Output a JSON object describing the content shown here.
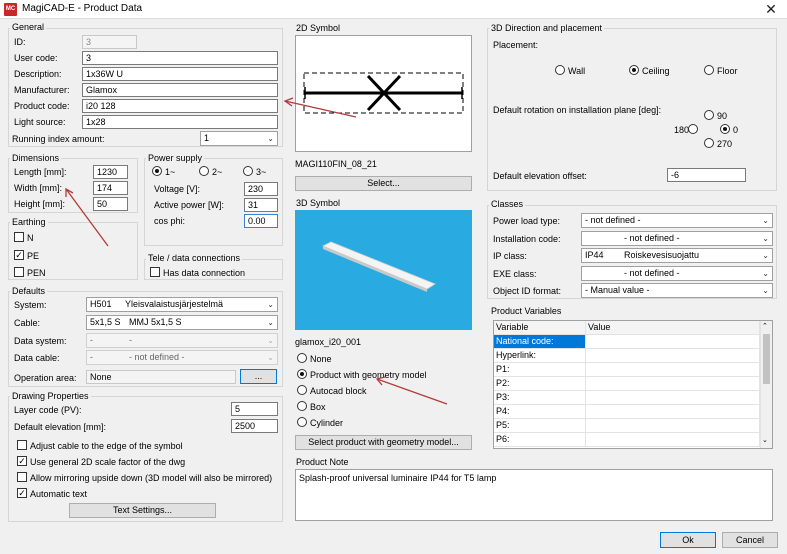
{
  "window": {
    "title": "MagiCAD-E - Product Data",
    "icon_text": "MC",
    "close_glyph": "✕"
  },
  "general": {
    "label": "General",
    "id_label": "ID:",
    "id_value": "3",
    "user_code_label": "User code:",
    "user_code_value": "3",
    "description_label": "Description:",
    "description_value": "1x36W U",
    "manufacturer_label": "Manufacturer:",
    "manufacturer_value": "Glamox",
    "product_code_label": "Product code:",
    "product_code_value": "i20 128",
    "light_source_label": "Light source:",
    "light_source_value": "1x28",
    "running_index_label": "Running index amount:",
    "running_index_value": "1"
  },
  "dimensions": {
    "label": "Dimensions",
    "length_label": "Length [mm]:",
    "length_value": "1230",
    "width_label": "Width [mm]:",
    "width_value": "174",
    "height_label": "Height [mm]:",
    "height_value": "50"
  },
  "power_supply": {
    "label": "Power supply",
    "options": [
      "1~",
      "2~",
      "3~"
    ],
    "selected": "1~",
    "voltage_label": "Voltage [V]:",
    "voltage_value": "230",
    "active_power_label": "Active power [W]:",
    "active_power_value": "31",
    "cos_phi_label": "cos phi:",
    "cos_phi_value": "0.00"
  },
  "earthing": {
    "label": "Earthing",
    "items": [
      {
        "label": "N",
        "checked": false
      },
      {
        "label": "PE",
        "checked": true
      },
      {
        "label": "PEN",
        "checked": false
      }
    ],
    "check_glyph": "✓"
  },
  "tele": {
    "label": "Tele / data connections",
    "has_data_label": "Has data connection"
  },
  "defaults": {
    "label": "Defaults",
    "system_label": "System:",
    "system_code": "H501",
    "system_name": "Yleisvalaistusjärjestelmä",
    "cable_label": "Cable:",
    "cable_code": "5x1,5 S",
    "cable_name": "MMJ 5x1,5 S",
    "data_system_label": "Data system:",
    "data_system_code": "-",
    "data_system_name": "-",
    "data_cable_label": "Data cable:",
    "data_cable_code": "-",
    "data_cable_name": "- not defined -",
    "operation_area_label": "Operation area:",
    "operation_area_value": "None",
    "operation_area_button": "..."
  },
  "drawing": {
    "label": "Drawing Properties",
    "layer_code_label": "Layer code (PV):",
    "layer_code_value": "5",
    "default_elevation_label": "Default elevation [mm]:",
    "default_elevation_value": "2500",
    "options": [
      {
        "label": "Adjust cable to the edge of the symbol",
        "checked": false
      },
      {
        "label": "Use general 2D scale factor of the dwg",
        "checked": true
      },
      {
        "label": "Allow mirroring upside down (3D model will also be mirrored)",
        "checked": false
      },
      {
        "label": "Automatic text",
        "checked": true
      }
    ],
    "text_settings_button": "Text Settings..."
  },
  "symbol_2d": {
    "label": "2D Symbol",
    "name": "MAGI110FIN_08_21",
    "select_button": "Select..."
  },
  "symbol_3d": {
    "label": "3D Symbol",
    "name": "glamox_i20_001",
    "options": [
      "None",
      "Product with geometry model",
      "Autocad block",
      "Box",
      "Cylinder"
    ],
    "selected": "Product with geometry model",
    "select_button": "Select product with geometry model...",
    "preview_bg": "#29abe2"
  },
  "direction": {
    "label": "3D Direction and placement",
    "placement_label": "Placement:",
    "placement_options": [
      "Wall",
      "Ceiling",
      "Floor"
    ],
    "placement_selected": "Ceiling",
    "rotation_label": "Default rotation on installation plane [deg]:",
    "rotation_options": [
      "90",
      "180",
      "0",
      "270"
    ],
    "rotation_selected": "0",
    "elevation_offset_label": "Default elevation offset:",
    "elevation_offset_value": "-6"
  },
  "classes": {
    "label": "Classes",
    "power_load_label": "Power load type:",
    "power_load_value": "- not defined -",
    "installation_code_label": "Installation code:",
    "installation_code_value": "- not defined -",
    "ip_class_label": "IP class:",
    "ip_class_code": "IP44",
    "ip_class_name": "Roiskevesisuojattu",
    "exe_class_label": "EXE class:",
    "exe_class_value": "- not defined -",
    "object_id_label": "Object ID format:",
    "object_id_value": "- Manual value -"
  },
  "product_variables": {
    "label": "Product Variables",
    "col_variable": "Variable",
    "col_value": "Value",
    "rows": [
      "National code:",
      "Hyperlink:",
      "P1:",
      "P2:",
      "P3:",
      "P4:",
      "P5:",
      "P6:"
    ],
    "selected_row": 0
  },
  "product_note": {
    "label": "Product Note",
    "text": "Splash-proof universal luminaire IP44 for T5 lamp"
  },
  "footer": {
    "ok": "Ok",
    "cancel": "Cancel"
  },
  "colors": {
    "accent": "#0078d7",
    "annotation_arrow": "#b23a3a",
    "selection": "#0078d7"
  }
}
